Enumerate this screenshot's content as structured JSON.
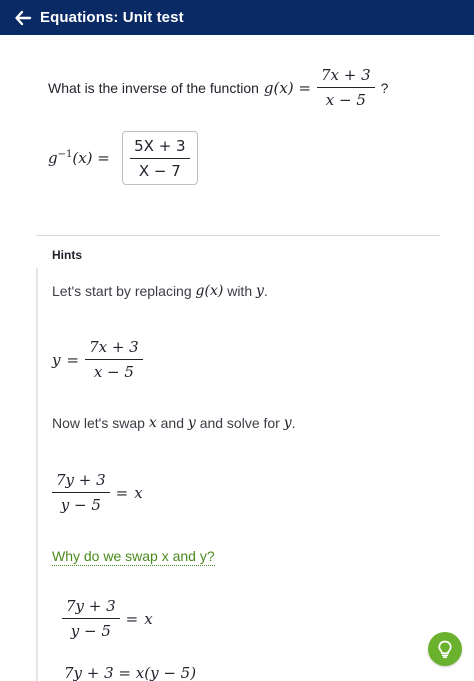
{
  "header": {
    "title": "Equations: Unit test",
    "background": "#0a2a66",
    "back_icon": "arrow-left-icon"
  },
  "question": {
    "prompt": "What is the inverse of the function",
    "function_lhs": "g(x) =",
    "numerator": "7x + 3",
    "denominator": "x − 5",
    "question_mark": "?"
  },
  "answer": {
    "lhs_base": "g",
    "lhs_exponent": "−1",
    "lhs_rest": "(x) =",
    "numerator": "5X + 3",
    "denominator": "X − 7"
  },
  "hints": {
    "label": "Hints",
    "step1": {
      "text_a": "Let's start by replacing",
      "math_a": "g(x)",
      "text_b": "with",
      "math_b": "y",
      "text_c": "."
    },
    "eq1": {
      "lhs": "y",
      "op": "=",
      "numerator": "7x + 3",
      "denominator": "x − 5"
    },
    "step2": {
      "text_a": "Now let's swap",
      "math_a": "x",
      "text_b": "and",
      "math_b": "y",
      "text_c": "and solve for",
      "math_c": "y",
      "text_d": "."
    },
    "eq2": {
      "numerator": "7y + 3",
      "denominator": "y − 5",
      "op": "=",
      "rhs": "x"
    },
    "why_link": "Why do we swap x and y?",
    "eq3": {
      "numerator": "7y + 3",
      "denominator": "y − 5",
      "op": "=",
      "rhs": "x"
    },
    "eq4_partial": "7y + 3 = x(y − 5)"
  },
  "accent_colors": {
    "link": "#4a8a1c",
    "hint_button": "#6ab22e"
  },
  "hint_button_icon": "lightbulb-icon"
}
